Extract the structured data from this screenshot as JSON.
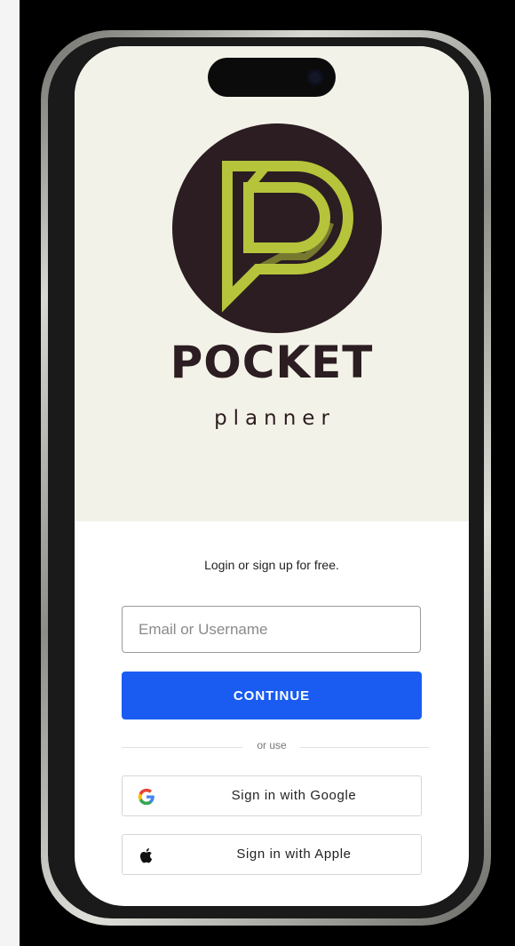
{
  "brand": {
    "title": "POCKET",
    "subtitle": "planner",
    "logo_icon": "pocket-planner-logo",
    "colors": {
      "dark": "#2b1d21",
      "lime": "#b5c43a",
      "hero_bg": "#f3f2e8"
    }
  },
  "login": {
    "tagline": "Login or sign up for free.",
    "email_placeholder": "Email or Username",
    "email_value": "",
    "continue_label": "CONTINUE",
    "continue_color": "#1a5cf2",
    "divider_label": "or use",
    "google_label": "Sign in with Google",
    "google_icon": "google-icon",
    "apple_label": "Sign in with Apple",
    "apple_icon": "apple-icon"
  }
}
